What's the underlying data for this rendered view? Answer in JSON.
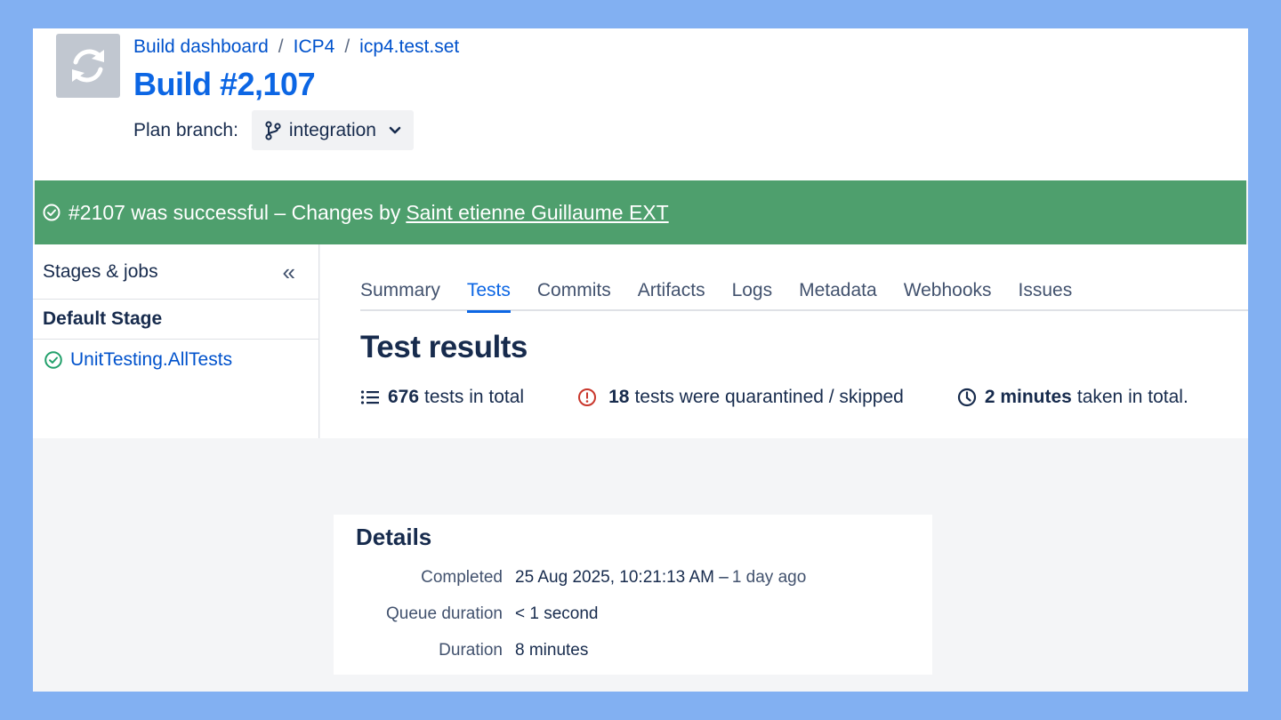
{
  "header": {
    "breadcrumbs": [
      "Build dashboard",
      "ICP4",
      "icp4.test.set"
    ],
    "title": "Build #2,107",
    "plan_branch_label": "Plan branch:",
    "plan_branch_value": "integration"
  },
  "status": {
    "message": "#2107 was successful – Changes by",
    "author": "Saint etienne Guillaume EXT",
    "color": "#4e9f6d"
  },
  "sidebar": {
    "title": "Stages & jobs",
    "collapse_glyph": "«",
    "stage": "Default Stage",
    "job": "UnitTesting.AllTests"
  },
  "tabs": [
    "Summary",
    "Tests",
    "Commits",
    "Artifacts",
    "Logs",
    "Metadata",
    "Webhooks",
    "Issues"
  ],
  "active_tab": "Tests",
  "test_results": {
    "title": "Test results",
    "total_count": "676",
    "total_text": "tests in total",
    "quarantined_count": "18",
    "quarantined_text": "tests were quarantined / skipped",
    "duration_value": "2 minutes",
    "duration_text": "taken in total."
  },
  "details": {
    "title": "Details",
    "completed_label": "Completed",
    "completed_value": "25 Aug 2025, 10:21:13 AM –",
    "completed_relative": "1 day ago",
    "queue_label": "Queue duration",
    "queue_value": "< 1 second",
    "duration_label": "Duration",
    "duration_value": "8 minutes"
  },
  "colors": {
    "accent": "#0c66e4",
    "link": "#0052cc",
    "success": "#4e9f6d",
    "warning": "#c9372c",
    "background": "#82b0f2"
  }
}
